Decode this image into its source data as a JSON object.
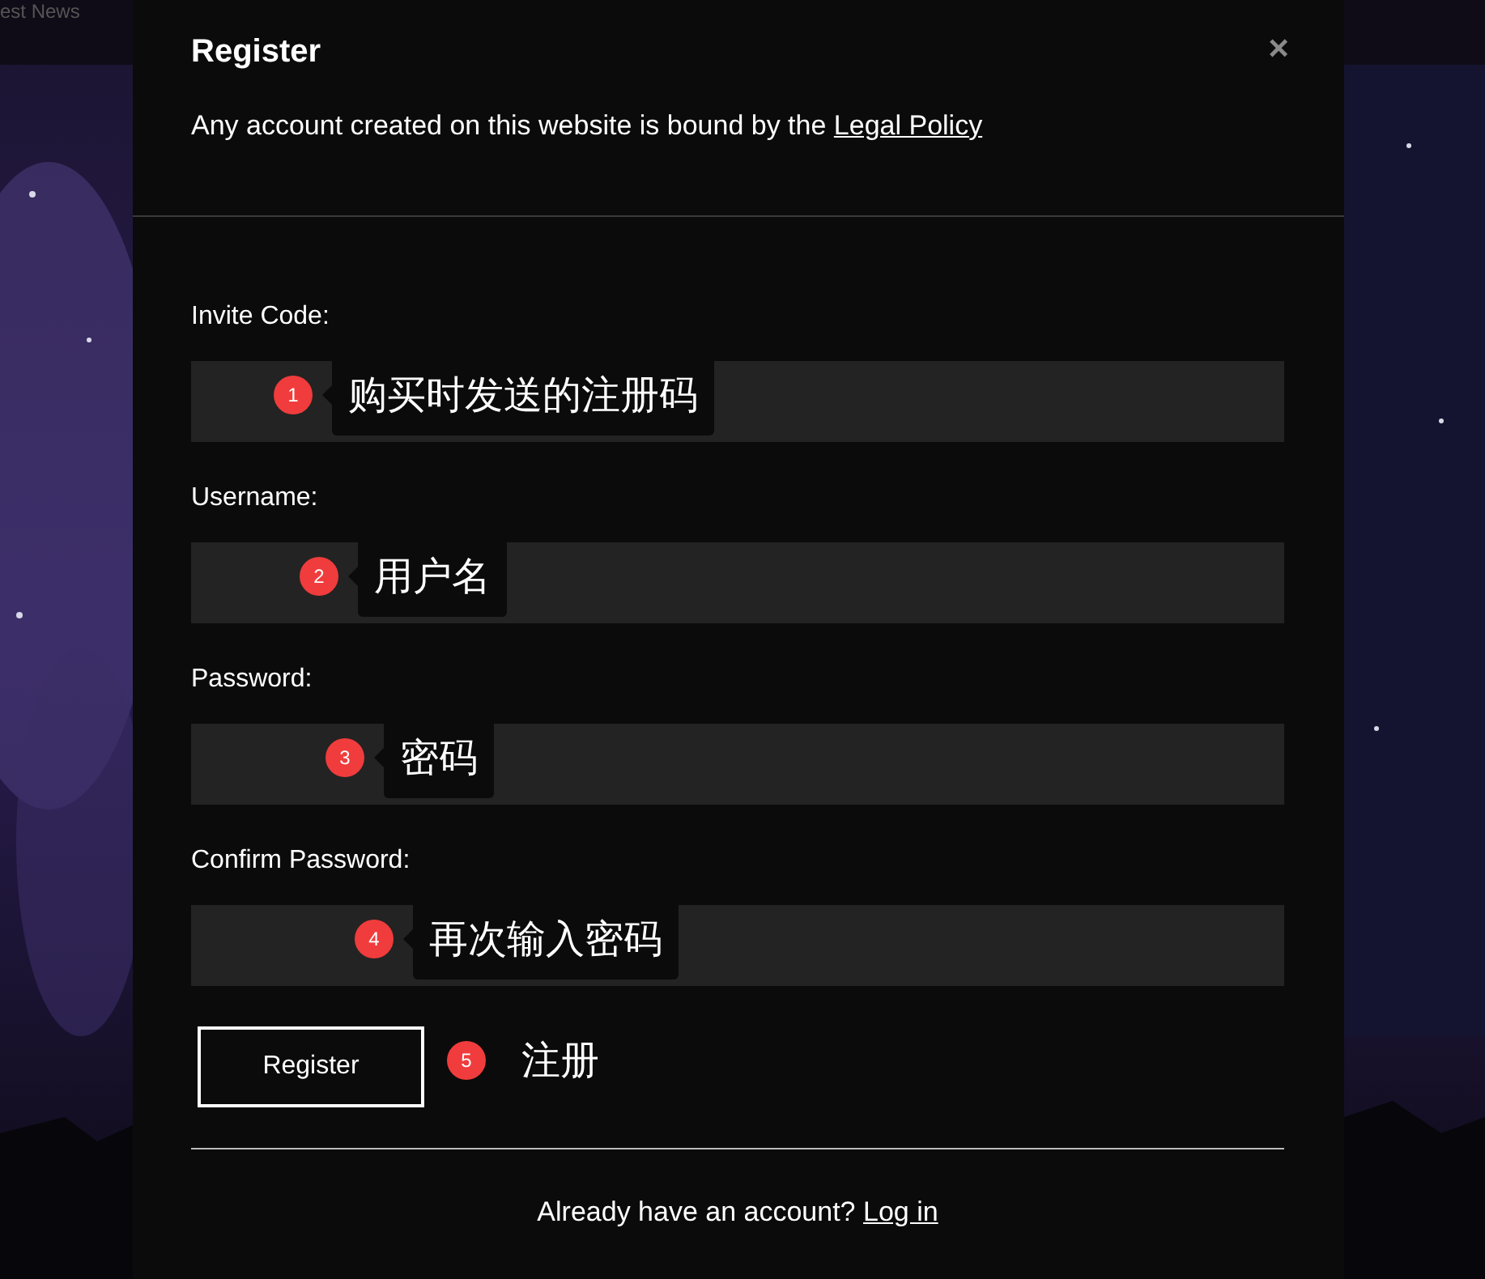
{
  "background_header": {
    "text": "est News"
  },
  "dialog": {
    "title": "Register",
    "close": "×",
    "notice": {
      "text": "Any account created on this website is bound by the",
      "link": "Legal Policy"
    },
    "fields": [
      {
        "label": "Invite Code:",
        "annotation": {
          "number": "1",
          "text": "购买时发送的注册码"
        }
      },
      {
        "label": "Username:",
        "annotation": {
          "number": "2",
          "text": "用户名"
        }
      },
      {
        "label": "Password:",
        "annotation": {
          "number": "3",
          "text": "密码"
        }
      },
      {
        "label": "Confirm Password:",
        "annotation": {
          "number": "4",
          "text": "再次输入密码"
        }
      }
    ],
    "submit": {
      "label": "Register",
      "annotation": {
        "number": "5",
        "text": "注册"
      }
    },
    "footer": {
      "text": "Already have an account?",
      "link": "Log in"
    }
  }
}
